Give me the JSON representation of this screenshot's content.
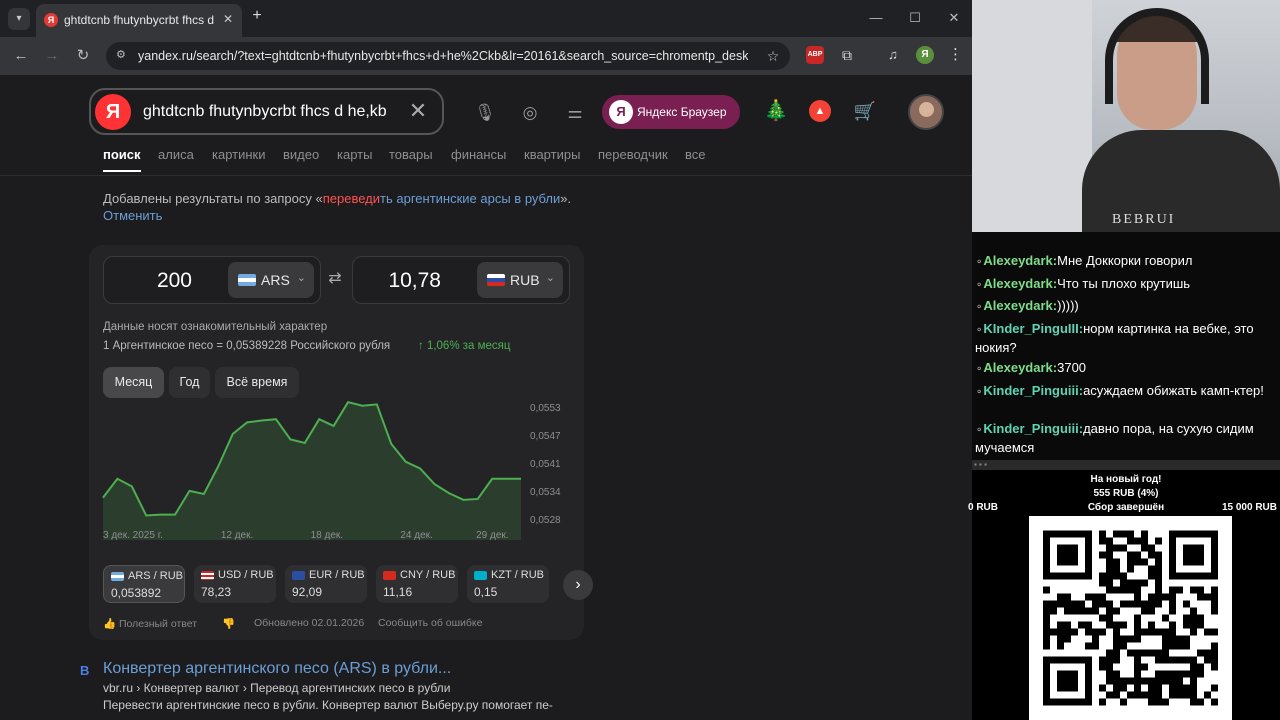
{
  "browser": {
    "tab": {
      "title": "ghtdtcnb fhutynbycrbt fhcs d he,kb",
      "favicon": "Я"
    },
    "window_controls": {
      "minimize": "—",
      "maximize": "☐",
      "close": "✕"
    },
    "nav": {
      "back": "←",
      "forward": "→",
      "reload": "↻"
    },
    "url": "yandex.ru/search/?text=ghtdtcnb+fhutynbycrbt+fhcs+d+he%2Ckb&lr=20161&search_source=chromentp_deskt...",
    "extensions": {
      "abp": "ABP",
      "profile": "Я"
    }
  },
  "search": {
    "logo": "Я",
    "query": "ghtdtcnb fhutynbycrbt fhcs d he,kb",
    "yandex_browser_label": "Яндекс Браузер",
    "tabs": [
      "поиск",
      "алиса",
      "картинки",
      "видео",
      "карты",
      "товары",
      "финансы",
      "квартиры",
      "переводчик",
      "все"
    ],
    "notice": {
      "prefix": "Добавлены результаты по запросу «",
      "highlight_red": "переведи",
      "highlight_rest": "ть аргентинские арсы в рубли",
      "suffix": "». ",
      "cancel": "Отменить"
    }
  },
  "converter": {
    "from_amount": "200",
    "from_currency": "ARS",
    "to_amount": "10,78",
    "to_currency": "RUB",
    "disclaimer": "Данные носят ознакомительный характер",
    "rate_text": "1 Аргентинское песо = 0,05389228 Российского рубля",
    "rate_change": "↑ 1,06%  за месяц",
    "periods": [
      "Месяц",
      "Год",
      "Всё время"
    ],
    "pairs": [
      {
        "name": "ARS / RUB",
        "value": "0,053892"
      },
      {
        "name": "USD / RUB",
        "value": "78,23"
      },
      {
        "name": "EUR / RUB",
        "value": "92,09"
      },
      {
        "name": "CNY / RUB",
        "value": "11,16"
      },
      {
        "name": "KZT / RUB",
        "value": "0,15"
      }
    ],
    "footer": {
      "helpful": "Полезный ответ",
      "updated": "Обновлено 02.01.2026",
      "report": "Сообщить об ошибке"
    }
  },
  "chart_data": {
    "type": "line",
    "x_tick_labels": [
      "3 дек. 2025 г.",
      "12 дек.",
      "18 дек.",
      "24 дек.",
      "29 дек."
    ],
    "y_tick_labels": [
      "0,0553",
      "0,0547",
      "0,0541",
      "0,0534",
      "0,0528"
    ],
    "ylim": [
      0.0528,
      0.0553
    ],
    "series": [
      {
        "values": [
          0.0533,
          0.05372,
          0.05355,
          0.0529,
          0.05292,
          0.05292,
          0.05345,
          0.05338,
          0.054,
          0.05472,
          0.05498,
          0.05502,
          0.05505,
          0.0546,
          0.05452,
          0.05505,
          0.0549,
          0.05543,
          0.05535,
          0.05538,
          0.0545,
          0.0541,
          0.05395,
          0.0536,
          0.0534,
          0.05325,
          0.05327,
          0.05372,
          0.05372,
          0.05372
        ]
      }
    ],
    "color": "#4caf50",
    "area_fill": true,
    "grid": false
  },
  "result": {
    "favicon": "В",
    "title": "Конвертер аргентинского песо (ARS) в рубли...",
    "url": "vbr.ru › Конвертер валют › Перевод аргентинских песо в рубли",
    "snippet": "Перевести аргентинские песо в рубли. Конвертер валют Выберу.ру помогает пе-"
  },
  "stream": {
    "webcam_shirt_text": "BEBRUI",
    "chat": [
      {
        "user": "Alexeydark:",
        "text": "Мне Доккорки говорил"
      },
      {
        "user": "Alexeydark:",
        "text": "Что ты плохо крутишь"
      },
      {
        "user": "Alexeydark:",
        "text": ")))))"
      },
      {
        "user": "KInder_PinguIII:",
        "text": "норм картинка на вебке, это нокия?"
      },
      {
        "user": "Alexeydark:",
        "text": "3700"
      },
      {
        "user": "Kinder_Pinguiii:",
        "text": "асуждаем обижать камп-ктер!"
      },
      {
        "user": "Kinder_Pinguiii:",
        "text": "давно пора, на сухую сидим мучаемся"
      }
    ],
    "goal": {
      "title": "На новый год!",
      "progress": "555 RUB (4%)",
      "progress_fraction": 0.04,
      "min": "0 RUB",
      "status": "Сбор завершён",
      "max": "15 000 RUB"
    }
  }
}
